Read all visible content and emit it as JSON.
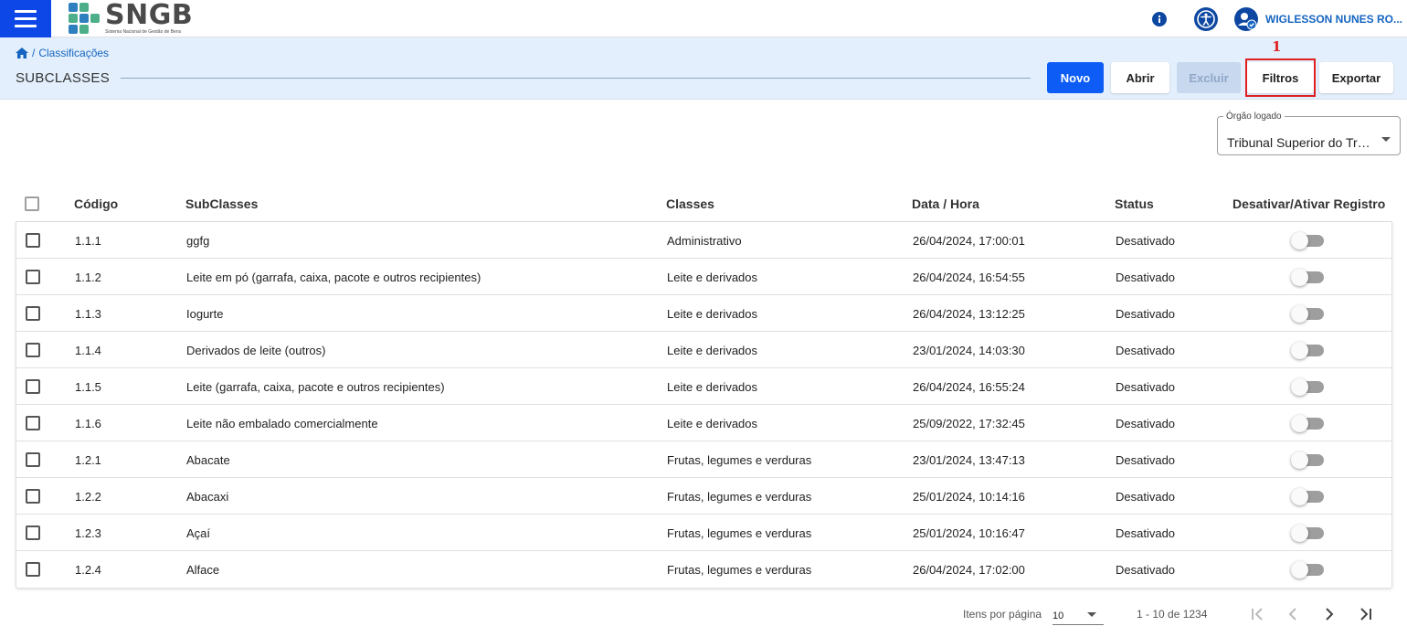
{
  "app": {
    "logo_text": "SNGB",
    "logo_subtitle": "Sistema Nacional de Gestão de Bens",
    "user_name": "WIGLESSON NUNES RO..."
  },
  "breadcrumb": {
    "separator": "/",
    "current": "Classificações"
  },
  "page_title": "SUBCLASSES",
  "toolbar": {
    "novo": "Novo",
    "abrir": "Abrir",
    "excluir": "Excluir",
    "filtros": "Filtros",
    "exportar": "Exportar"
  },
  "annotation": {
    "number": "1",
    "color": "#e02020"
  },
  "orgao": {
    "label": "Órgão logado",
    "value": "Tribunal Superior do Trabalho"
  },
  "table": {
    "headers": {
      "codigo": "Código",
      "subclasses": "SubClasses",
      "classes": "Classes",
      "data_hora": "Data / Hora",
      "status": "Status",
      "toggle": "Desativar/Ativar Registro"
    },
    "rows": [
      {
        "codigo": "1.1.1",
        "subclasse": "ggfg",
        "classe": "Administrativo",
        "data_hora": "26/04/2024, 17:00:01",
        "status": "Desativado"
      },
      {
        "codigo": "1.1.2",
        "subclasse": "Leite em pó (garrafa, caixa, pacote e outros recipientes)",
        "classe": "Leite e derivados",
        "data_hora": "26/04/2024, 16:54:55",
        "status": "Desativado"
      },
      {
        "codigo": "1.1.3",
        "subclasse": "Iogurte",
        "classe": "Leite e derivados",
        "data_hora": "26/04/2024, 13:12:25",
        "status": "Desativado"
      },
      {
        "codigo": "1.1.4",
        "subclasse": "Derivados de leite (outros)",
        "classe": "Leite e derivados",
        "data_hora": "23/01/2024, 14:03:30",
        "status": "Desativado"
      },
      {
        "codigo": "1.1.5",
        "subclasse": "Leite (garrafa, caixa, pacote e outros recipientes)",
        "classe": "Leite e derivados",
        "data_hora": "26/04/2024, 16:55:24",
        "status": "Desativado"
      },
      {
        "codigo": "1.1.6",
        "subclasse": "Leite não embalado comercialmente",
        "classe": "Leite e derivados",
        "data_hora": "25/09/2022, 17:32:45",
        "status": "Desativado"
      },
      {
        "codigo": "1.2.1",
        "subclasse": "Abacate",
        "classe": "Frutas, legumes e verduras",
        "data_hora": "23/01/2024, 13:47:13",
        "status": "Desativado"
      },
      {
        "codigo": "1.2.2",
        "subclasse": "Abacaxi",
        "classe": "Frutas, legumes e verduras",
        "data_hora": "25/01/2024, 10:14:16",
        "status": "Desativado"
      },
      {
        "codigo": "1.2.3",
        "subclasse": "Açaí",
        "classe": "Frutas, legumes e verduras",
        "data_hora": "25/01/2024, 10:16:47",
        "status": "Desativado"
      },
      {
        "codigo": "1.2.4",
        "subclasse": "Alface",
        "classe": "Frutas, legumes e verduras",
        "data_hora": "26/04/2024, 17:02:00",
        "status": "Desativado"
      }
    ]
  },
  "pagination": {
    "items_label": "Itens por página",
    "page_size": "10",
    "range": "1 - 10 de 1234"
  },
  "colors": {
    "primary": "#0d5cf5",
    "header_bg": "#e3effc",
    "link": "#1565c0"
  }
}
